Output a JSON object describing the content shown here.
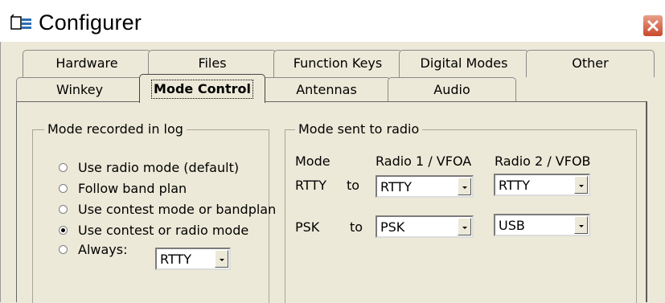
{
  "window": {
    "title": "Configurer"
  },
  "tabs_row1": [
    "Hardware",
    "Files",
    "Function Keys",
    "Digital Modes",
    "Other"
  ],
  "tabs_row2": [
    "Winkey",
    "Mode Control",
    "Antennas",
    "Audio"
  ],
  "active_tab": "Mode Control",
  "mode_log": {
    "legend": "Mode recorded in log",
    "options": [
      "Use radio mode (default)",
      "Follow band plan",
      "Use contest mode or bandplan",
      "Use contest or radio mode",
      "Always:"
    ],
    "selected": "Use contest or radio mode",
    "always_value": "RTTY"
  },
  "mode_radio": {
    "legend": "Mode sent to radio",
    "col_mode": "Mode",
    "col_radio1": "Radio 1 / VFOA",
    "col_radio2": "Radio 2 / VFOB",
    "rows": [
      {
        "mode": "RTTY",
        "to": "to",
        "radio1": "RTTY",
        "radio2": "RTTY"
      },
      {
        "mode": "PSK",
        "to": "to",
        "radio1": "PSK",
        "radio2": "USB"
      }
    ]
  }
}
